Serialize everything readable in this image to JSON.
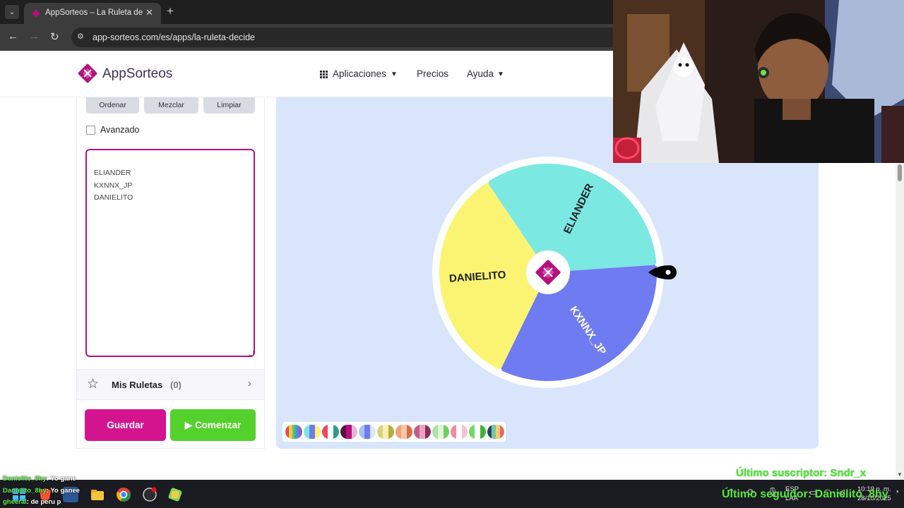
{
  "browser": {
    "tab_title": "AppSorteos – La Ruleta de la Su",
    "tab_close": "✕",
    "new_tab": "+",
    "url": "app-sorteos.com/es/apps/la-ruleta-decide"
  },
  "header": {
    "logo_text": "AppSorteos",
    "nav": [
      {
        "label": "Aplicaciones"
      },
      {
        "label": "Precios"
      },
      {
        "label": "Ayuda"
      }
    ]
  },
  "left_panel": {
    "buttons": [
      {
        "label": "Ordenar"
      },
      {
        "label": "Mezclar"
      },
      {
        "label": "Limpiar"
      }
    ],
    "advanced_label": "Avanzado",
    "advanced_checked": false,
    "names": [
      "ELIANDER",
      "KXNNX_JP",
      "DANIELITO"
    ],
    "mis_ruletas": {
      "label": "Mis Ruletas",
      "count": "(0)"
    },
    "save_label": "Guardar",
    "start_label": "Comenzar"
  },
  "wheel": {
    "segments": [
      {
        "label": "ELIANDER",
        "color": "#7ce8e2"
      },
      {
        "label": "KXNNX_JP",
        "color": "#6f7bf0"
      },
      {
        "label": "DANIELITO",
        "color": "#fbf472"
      }
    ],
    "accent": "#b5107f"
  },
  "palettes": [
    [
      "#e94b4b",
      "#f7c948",
      "#59c36a",
      "#4a90e2",
      "#9b59b6"
    ],
    [
      "#7ce8e2",
      "#6f7bf0",
      "#fbf472"
    ],
    [
      "#e84a5f",
      "#ffffff",
      "#2a9d8f"
    ],
    [
      "#5c0f3a",
      "#b5107f",
      "#e3b6d4"
    ],
    [
      "#a8c1ef",
      "#6f7bf0",
      "#dde7fb"
    ],
    [
      "#d8d37a",
      "#f6f0b5",
      "#b7ac3c"
    ],
    [
      "#f2a07b",
      "#f5c6a5",
      "#d96c48"
    ],
    [
      "#c65b8b",
      "#e9a3c0",
      "#8c2d5c"
    ],
    [
      "#a9e4a0",
      "#dff6da",
      "#6fcf64"
    ],
    [
      "#f08aa3",
      "#ffffff",
      "#f5c2cf"
    ],
    [
      "#6fd96a",
      "#ffffff",
      "#3fb338"
    ],
    [
      "#27465c",
      "#77c69b",
      "#f3c97b",
      "#e36b5b"
    ]
  ],
  "overlay": {
    "last_subscriber": "Último suscriptor: Sndr_x",
    "last_follower": "Último seguidor: Danielito_8hy"
  },
  "chat": [
    {
      "user": "Danielito_8hy",
      "text": ": Yo gane"
    },
    {
      "user": "Danielito_8hy",
      "text": ": Yo ganee"
    },
    {
      "user": "gheeral",
      "text": ": de peru p"
    }
  ],
  "tray": {
    "lang_top": "ESP",
    "lang_bottom": "LAA",
    "time": "10:19 p. m.",
    "date": "28/10/2025"
  }
}
